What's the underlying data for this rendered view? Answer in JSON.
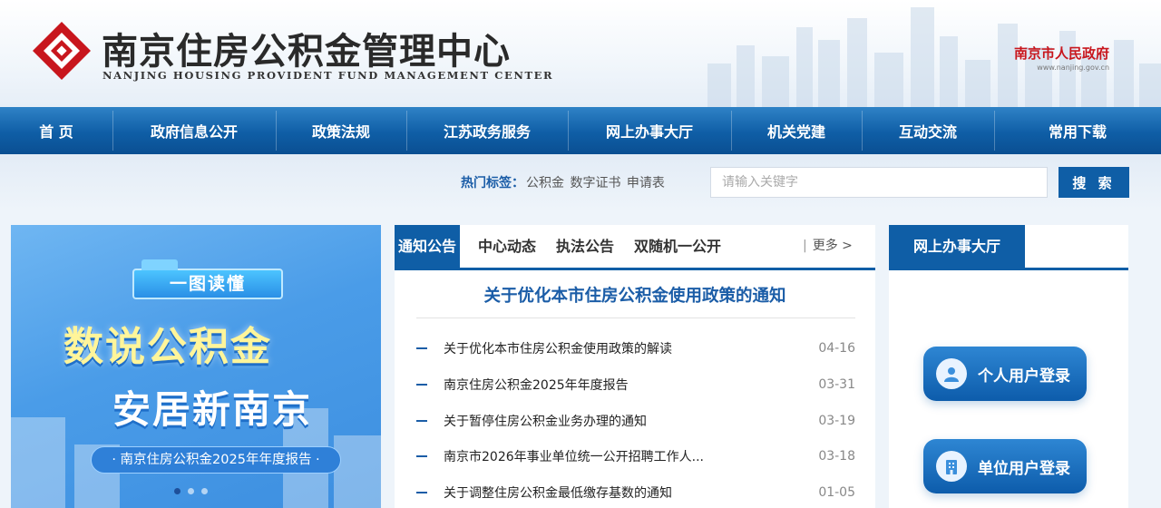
{
  "header": {
    "title": "南京住房公积金管理中心",
    "subtitle": "NANJING HOUSING PROVIDENT FUND MANAGEMENT CENTER",
    "gov_name": "南京市人民政府",
    "gov_url": "www.nanjing.gov.cn"
  },
  "nav": {
    "items": [
      {
        "label": "首 页"
      },
      {
        "label": "政府信息公开"
      },
      {
        "label": "政策法规"
      },
      {
        "label": "江苏政务服务"
      },
      {
        "label": "网上办事大厅"
      },
      {
        "label": "机关党建"
      },
      {
        "label": "互动交流"
      },
      {
        "label": "常用下载"
      }
    ]
  },
  "search": {
    "hot_label": "热门标签：",
    "hot_tags": [
      "公积金",
      "数字证书",
      "申请表"
    ],
    "placeholder": "请输入关键字",
    "button": "搜 索"
  },
  "banner": {
    "tag": "一图读懂",
    "title_line1": "数说公积金",
    "title_line2": "安居新南京",
    "caption": "· 南京住房公积金2025年年度报告 ·",
    "slide_count": 3,
    "active_slide": 1
  },
  "news": {
    "tabs": [
      "通知公告",
      "中心动态",
      "执法公告",
      "双随机一公开"
    ],
    "active_tab": 0,
    "more": "更多 >",
    "headline": "关于优化本市住房公积金使用政策的通知",
    "items": [
      {
        "title": "关于优化本市住房公积金使用政策的解读",
        "date": "04-16"
      },
      {
        "title": "南京住房公积金2025年年度报告",
        "date": "03-31"
      },
      {
        "title": "关于暂停住房公积金业务办理的通知",
        "date": "03-19"
      },
      {
        "title": "南京市2026年事业单位统一公开招聘工作人...",
        "date": "03-18"
      },
      {
        "title": "关于调整住房公积金最低缴存基数的通知",
        "date": "01-05"
      }
    ]
  },
  "hall": {
    "tab": "网上办事大厅",
    "personal_login": "个人用户登录",
    "unit_login": "单位用户登录"
  },
  "colors": {
    "brand_blue": "#0f5ea6",
    "logo_red": "#c8161d",
    "link_blue": "#1b5da7"
  }
}
